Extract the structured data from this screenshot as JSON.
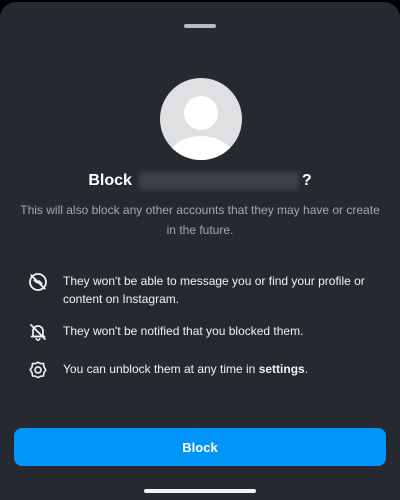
{
  "dialog": {
    "title_prefix": "Block",
    "title_suffix": "?",
    "subtitle": "This will also block any other accounts that they may have or create in the future."
  },
  "info_items": [
    {
      "icon": "message-off-icon",
      "text": "They won't be able to message you or find your profile or content on Instagram."
    },
    {
      "icon": "bell-off-icon",
      "text": "They won't be notified that you blocked them."
    },
    {
      "icon": "settings-gear-icon",
      "text_before": "You can unblock them at any time in ",
      "link": "settings",
      "text_after": "."
    }
  ],
  "actions": {
    "block_label": "Block"
  },
  "colors": {
    "sheet_background": "#262a30",
    "primary_button": "#0095f6",
    "secondary_text": "#a3a8af"
  }
}
